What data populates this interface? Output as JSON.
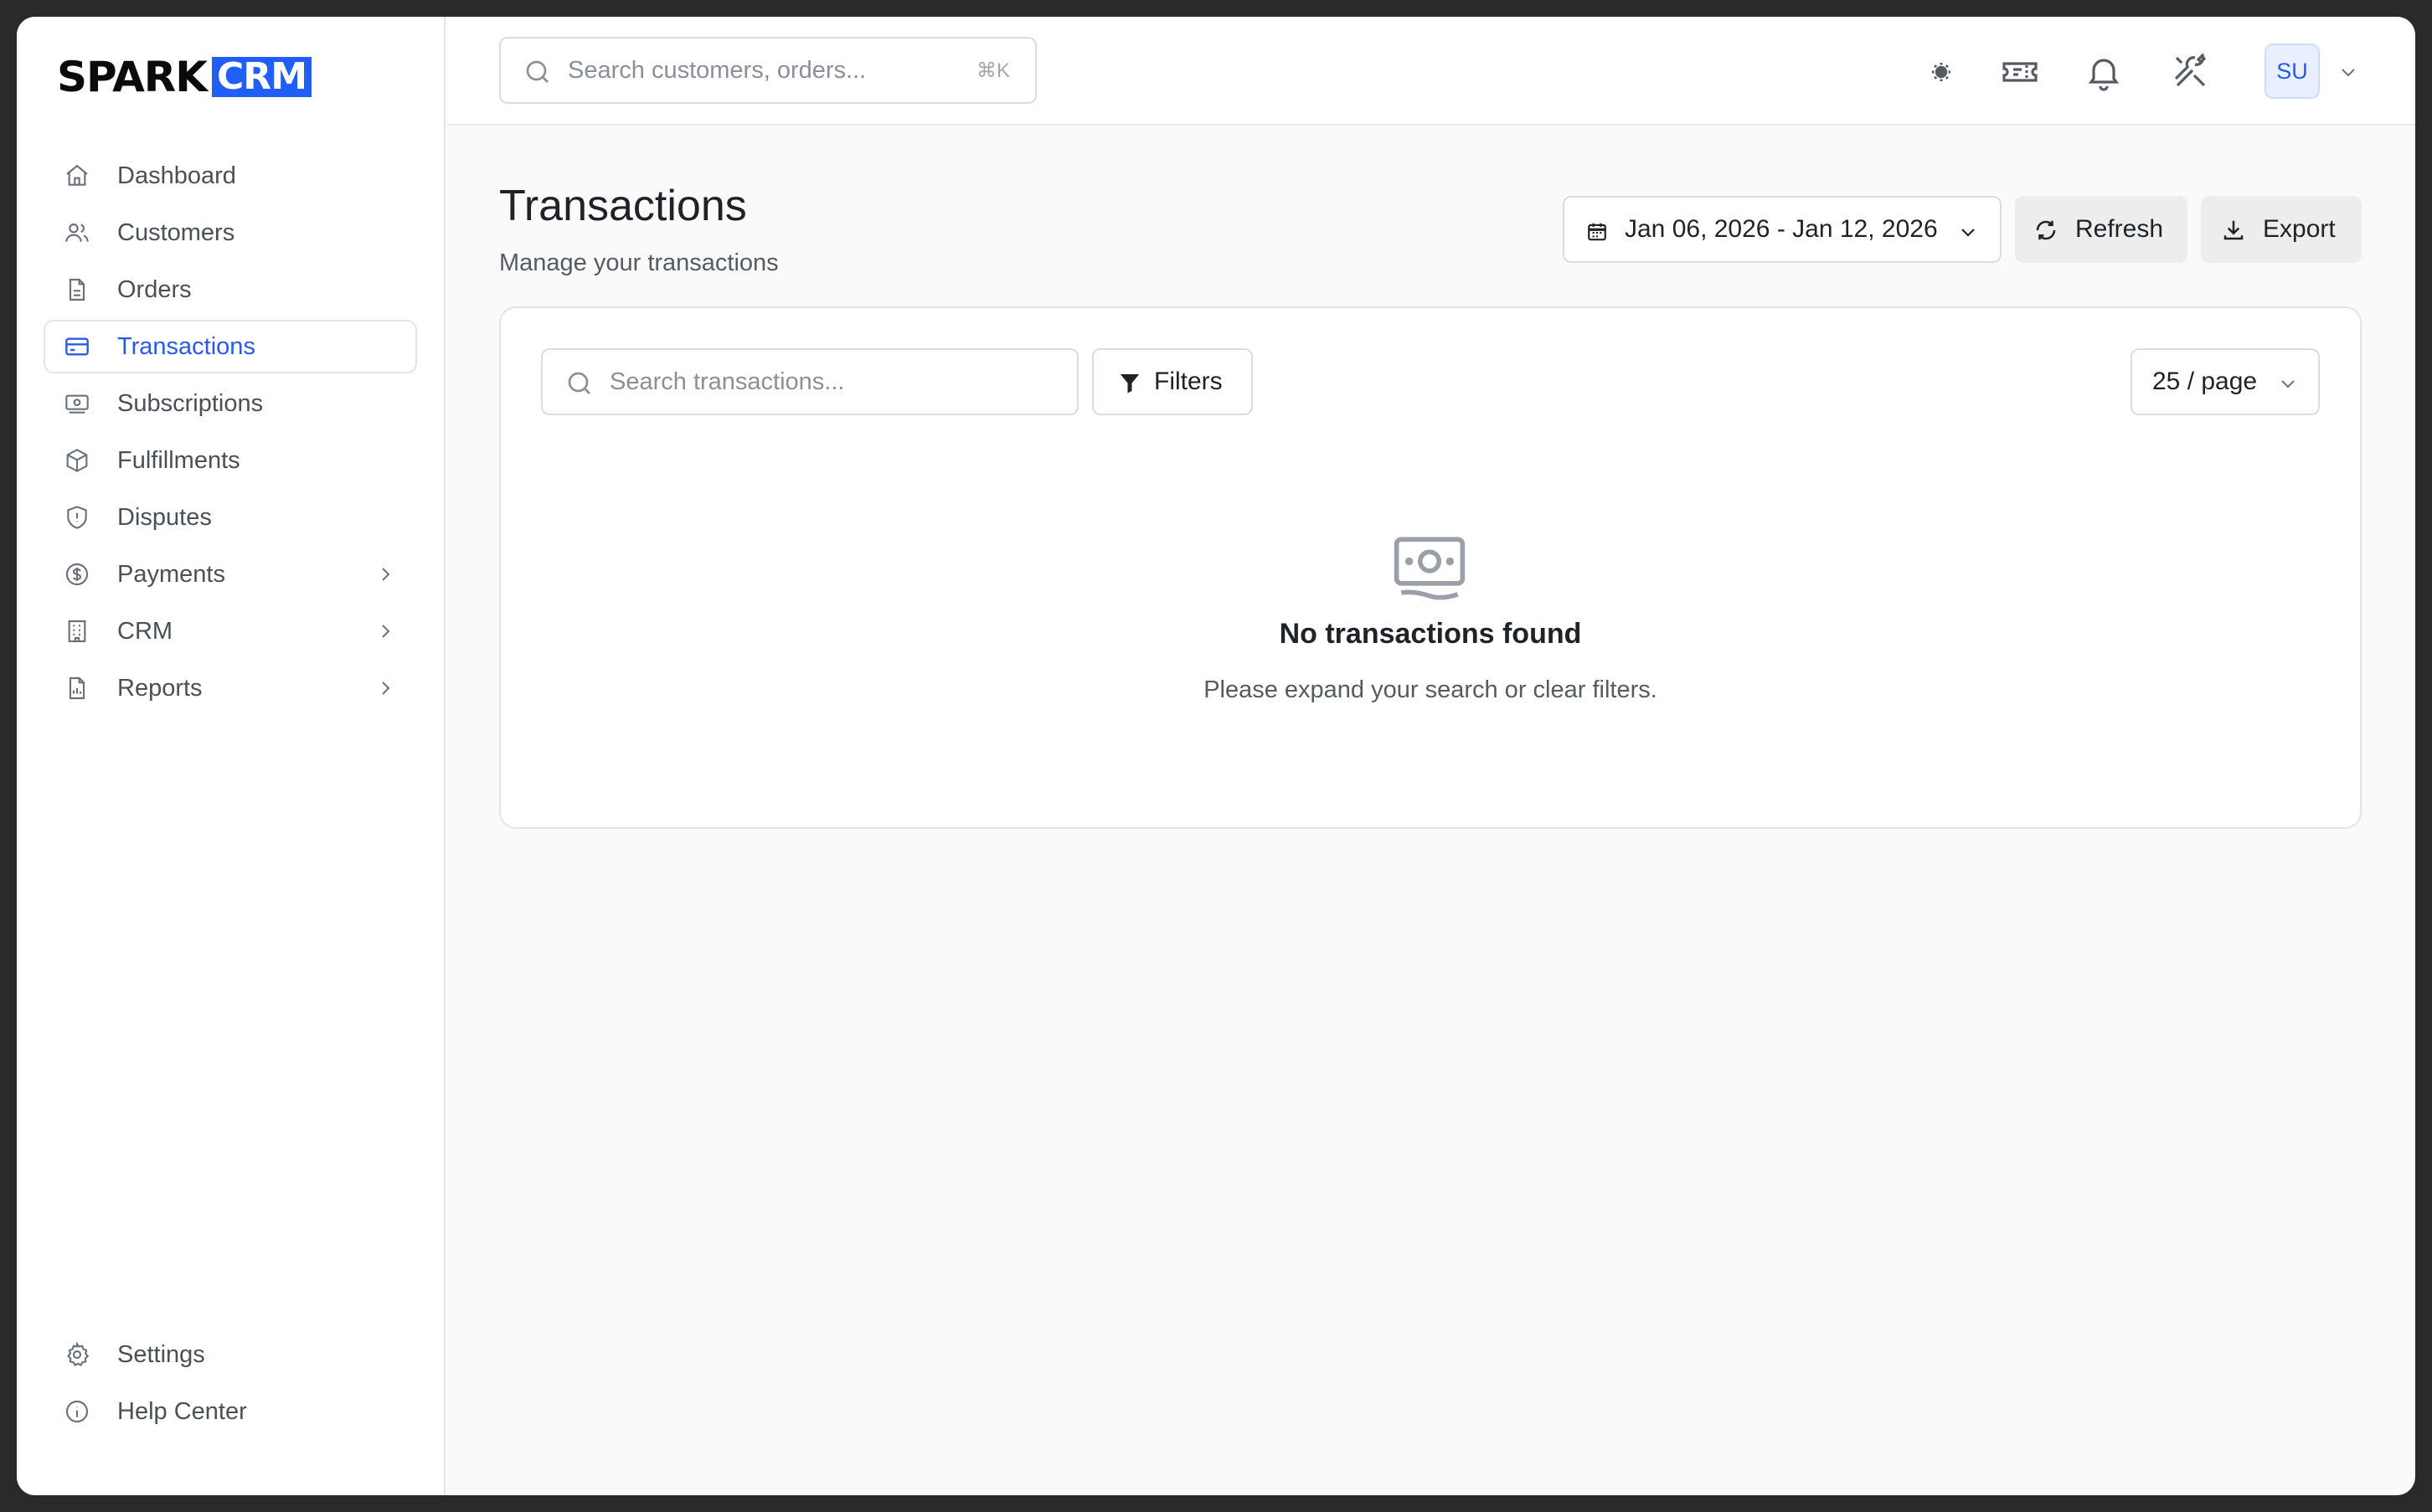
{
  "logo": {
    "part1": "SPARK",
    "part2": "CRM"
  },
  "sidebar": {
    "items": [
      {
        "label": "Dashboard",
        "icon": "home-icon"
      },
      {
        "label": "Customers",
        "icon": "users-icon"
      },
      {
        "label": "Orders",
        "icon": "file-icon"
      },
      {
        "label": "Transactions",
        "icon": "credit-card-icon",
        "active": true
      },
      {
        "label": "Subscriptions",
        "icon": "banknote-icon"
      },
      {
        "label": "Fulfillments",
        "icon": "package-icon"
      },
      {
        "label": "Disputes",
        "icon": "shield-icon"
      },
      {
        "label": "Payments",
        "icon": "dollar-circle-icon",
        "expandable": true
      },
      {
        "label": "CRM",
        "icon": "building-icon",
        "expandable": true
      },
      {
        "label": "Reports",
        "icon": "report-file-icon",
        "expandable": true
      }
    ],
    "bottom": [
      {
        "label": "Settings",
        "icon": "gear-icon"
      },
      {
        "label": "Help Center",
        "icon": "info-icon"
      }
    ]
  },
  "topbar": {
    "search_placeholder": "Search customers, orders...",
    "shortcut": "⌘K",
    "icons": [
      "sun-icon",
      "ticket-icon",
      "bell-icon",
      "tools-icon"
    ],
    "avatar_initials": "SU"
  },
  "page": {
    "title": "Transactions",
    "subtitle": "Manage your transactions",
    "date_range": "Jan 06, 2026 - Jan 12, 2026",
    "refresh_label": "Refresh",
    "export_label": "Export"
  },
  "panel": {
    "search_placeholder": "Search transactions...",
    "filters_label": "Filters",
    "per_page": "25 / page",
    "empty_title": "No transactions found",
    "empty_subtitle": "Please expand your search or clear filters."
  },
  "colors": {
    "accent": "#2a5ae8",
    "logo_blue": "#1f5ef7",
    "bg": "#fafafa"
  }
}
